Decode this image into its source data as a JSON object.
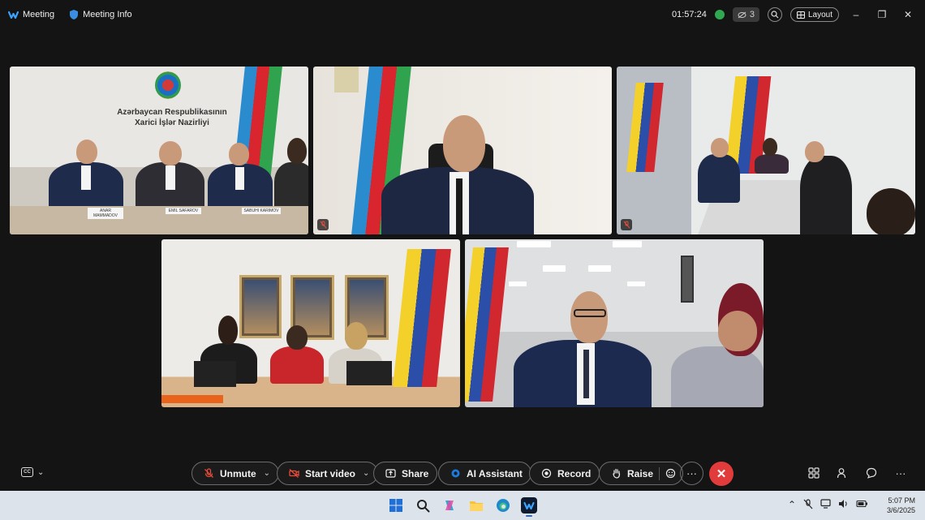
{
  "titlebar": {
    "app_name": "Meeting",
    "meeting_info": "Meeting Info",
    "timer": "01:57:24",
    "hidden_participants_count": "3",
    "layout_label": "Layout"
  },
  "tiles": [
    {
      "id": "tile-1",
      "wall_text_line1": "Azərbaycan Respublikasının",
      "wall_text_line2": "Xarici İşlər Nazirliyi",
      "nameplates": [
        "ANAR MAMMADOV",
        "EMIL SAFAROV",
        "SABUHI KARIMOV"
      ],
      "muted": false
    },
    {
      "id": "tile-2",
      "muted": true
    },
    {
      "id": "tile-3",
      "muted": true
    },
    {
      "id": "tile-4",
      "muted": false
    },
    {
      "id": "tile-5",
      "muted": false
    }
  ],
  "controls": {
    "unmute_label": "Unmute",
    "start_video_label": "Start video",
    "share_label": "Share",
    "ai_assistant_label": "AI Assistant",
    "record_label": "Record",
    "raise_label": "Raise",
    "more_label": "···"
  },
  "taskbar": {
    "time": "5:07 PM",
    "date": "3/6/2025"
  },
  "colors": {
    "end_call": "#e23b3b",
    "background": "#141414",
    "taskbar": "#dde3ea"
  }
}
